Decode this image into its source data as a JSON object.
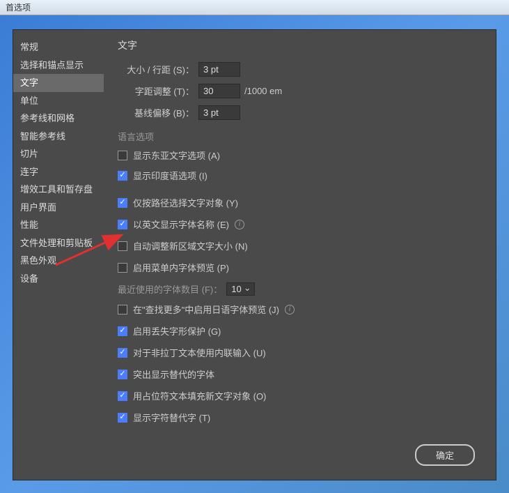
{
  "window": {
    "title": "首选项"
  },
  "sidebar": {
    "items": [
      {
        "label": "常规",
        "active": false
      },
      {
        "label": "选择和锚点显示",
        "active": false
      },
      {
        "label": "文字",
        "active": true
      },
      {
        "label": "单位",
        "active": false
      },
      {
        "label": "参考线和网格",
        "active": false
      },
      {
        "label": "智能参考线",
        "active": false
      },
      {
        "label": "切片",
        "active": false
      },
      {
        "label": "连字",
        "active": false
      },
      {
        "label": "增效工具和暂存盘",
        "active": false
      },
      {
        "label": "用户界面",
        "active": false
      },
      {
        "label": "性能",
        "active": false
      },
      {
        "label": "文件处理和剪贴板",
        "active": false
      },
      {
        "label": "黑色外观",
        "active": false
      },
      {
        "label": "设备",
        "active": false
      }
    ]
  },
  "content": {
    "title": "文字",
    "fields": {
      "size_leading_label": "大小 / 行距 (S)：",
      "size_leading_value": "3 pt",
      "tracking_label": "字距调整 (T)：",
      "tracking_value": "30",
      "tracking_unit": "/1000 em",
      "baseline_label": "基线偏移 (B)：",
      "baseline_value": "3 pt"
    },
    "language_section": {
      "title": "语言选项",
      "show_east_asian": {
        "label": "显示东亚文字选项 (A)",
        "checked": false
      },
      "show_indic": {
        "label": "显示印度语选项 (I)",
        "checked": true
      }
    },
    "options": {
      "select_by_path": {
        "label": "仅按路径选择文字对象 (Y)",
        "checked": true
      },
      "english_font_names": {
        "label": "以英文显示字体名称 (E)",
        "checked": true,
        "info": true
      },
      "auto_resize_area": {
        "label": "自动调整新区域文字大小 (N)",
        "checked": false
      },
      "enable_font_preview": {
        "label": "启用菜单内字体预览 (P)",
        "checked": false
      },
      "recent_fonts_label": "最近使用的字体数目 (F)：",
      "recent_fonts_value": "10",
      "japanese_preview": {
        "label": "在\"查找更多\"中启用日语字体预览 (J)",
        "checked": false,
        "info": true
      },
      "missing_glyph": {
        "label": "启用丢失字形保护 (G)",
        "checked": true
      },
      "inline_input": {
        "label": "对于非拉丁文本使用内联输入 (U)",
        "checked": true
      },
      "highlight_alt": {
        "label": "突出显示替代的字体",
        "checked": true
      },
      "placeholder_fill": {
        "label": "用占位符文本填充新文字对象 (O)",
        "checked": true
      },
      "show_char_alt": {
        "label": "显示字符替代字 (T)",
        "checked": true
      }
    }
  },
  "buttons": {
    "ok": "确定"
  }
}
